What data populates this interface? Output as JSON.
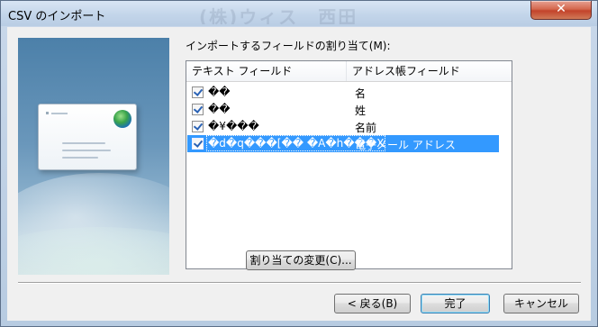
{
  "window": {
    "title": "CSV のインポート",
    "background_title_ghost": "(株)ウィス　西田",
    "close_label": "✕"
  },
  "mapping": {
    "label": "インポートするフィールドの割り当て(M):",
    "columns": [
      "テキスト フィールド",
      "アドレス帳フィールド"
    ],
    "rows": [
      {
        "text_field": "��",
        "address_field": "名",
        "checked": true,
        "selected": false
      },
      {
        "text_field": "��",
        "address_field": "姓",
        "checked": true,
        "selected": false
      },
      {
        "text_field": "�¥���",
        "address_field": "名前",
        "checked": true,
        "selected": false
      },
      {
        "text_field": "�d�q���[�� �A�h���X",
        "address_field": "電子メール アドレス",
        "checked": true,
        "selected": true
      }
    ]
  },
  "buttons": {
    "change_mapping": "割り当ての変更(C)...",
    "back": "< 戻る(B)",
    "finish": "完了",
    "cancel": "キャンセル"
  },
  "colors": {
    "selection": "#3399ff",
    "close_button": "#c3432a",
    "check_mark": "#2a62b5"
  },
  "icons": [
    "close-icon",
    "envelope-icon",
    "globe-stamp-icon",
    "checkbox-checked-icon"
  ]
}
